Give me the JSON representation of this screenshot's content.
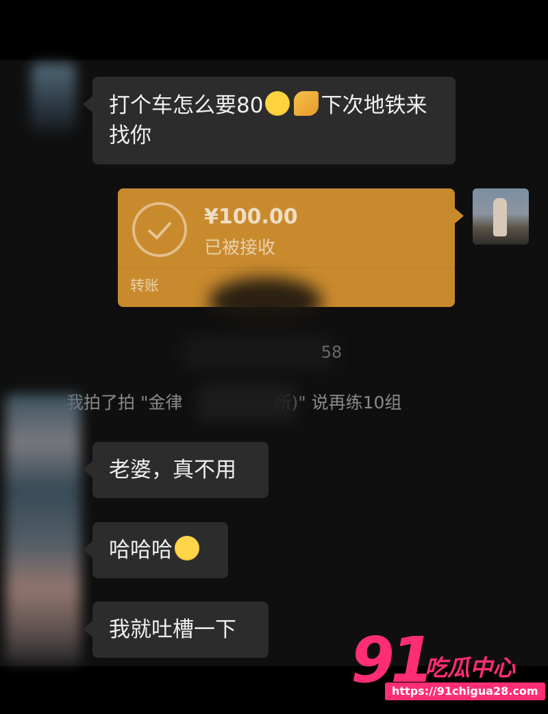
{
  "messages": [
    {
      "side": "left",
      "text": "打个车怎么要80",
      "after_emoji": "下次地铁来找你"
    },
    {
      "side": "left",
      "text": "老婆，真不用"
    },
    {
      "side": "left",
      "text": "哈哈哈"
    },
    {
      "side": "left",
      "text": "我就吐槽一下"
    }
  ],
  "transfer": {
    "amount": "¥100.00",
    "status": "已被接收",
    "label": "转账"
  },
  "system": {
    "time_fragment": "58",
    "pat_prefix": "我拍了拍 \"金律",
    "pat_suffix": "所)\" 说再练10组"
  },
  "watermark": {
    "number": "91",
    "title": "吃瓜中心",
    "url": "https://91chigua28.com"
  },
  "colors": {
    "transfer_bg": "#c98a2e",
    "bubble_bg": "#2c2c2c",
    "watermark": "#ff2e73"
  },
  "icons": [
    "cry-laugh-emoji",
    "clap-emoji",
    "grin-emoji",
    "check-circle-icon"
  ]
}
